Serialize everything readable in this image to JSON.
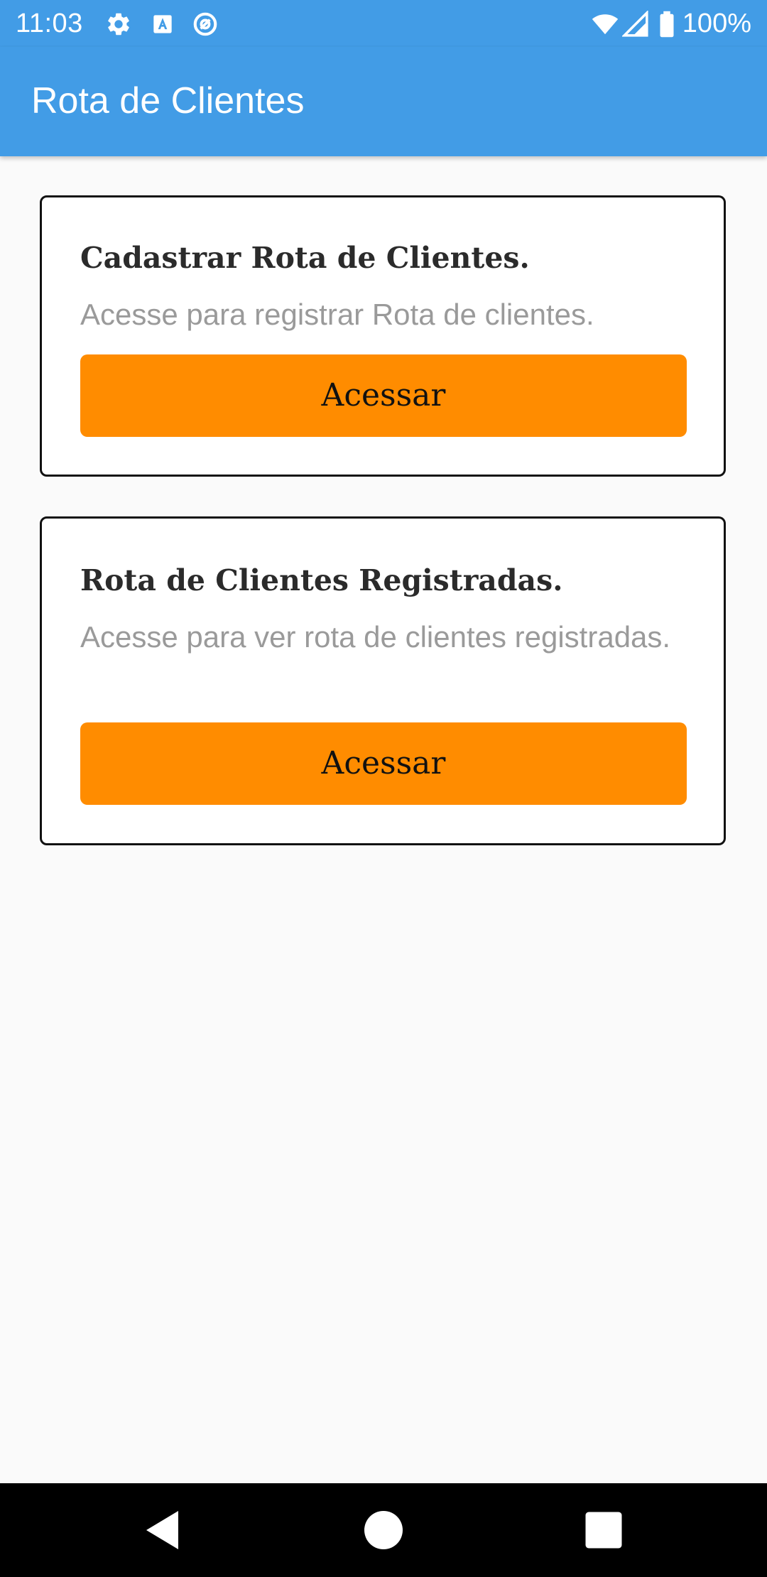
{
  "status_bar": {
    "time": "11:03",
    "battery": "100%",
    "icons": [
      "gear-icon",
      "text-a-icon",
      "at-sign-icon",
      "wifi-icon",
      "signal-icon",
      "battery-icon"
    ]
  },
  "app_bar": {
    "title": "Rota de Clientes",
    "color": "#429ce6"
  },
  "cards": [
    {
      "title": "Cadastrar Rota de Clientes.",
      "description": "Acesse para registrar Rota de clientes.",
      "button_label": "Acessar"
    },
    {
      "title": "Rota de Clientes Registradas.",
      "description": "Acesse para ver rota de clientes registradas.",
      "button_label": "Acessar"
    }
  ],
  "colors": {
    "accent": "#ff8c00",
    "primary": "#429ce6",
    "background": "#fafafa"
  },
  "nav_bar": {
    "icons": [
      "back-icon",
      "home-icon",
      "recents-icon"
    ]
  }
}
